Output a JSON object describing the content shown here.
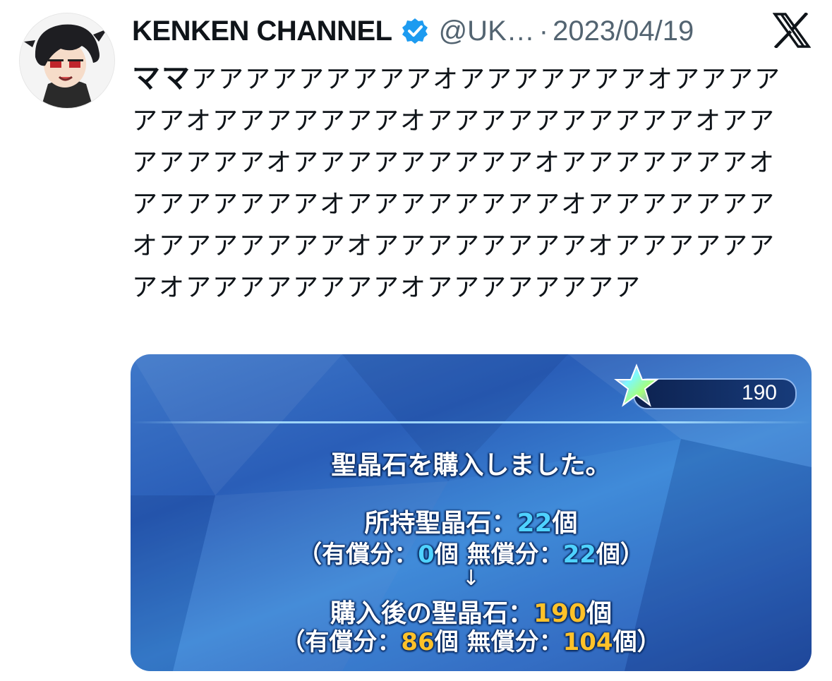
{
  "author": {
    "name": "KENKEN CHANNEL",
    "handle": "@UK…",
    "separator": "·",
    "date": "2023/04/19",
    "verified_icon": "verified-badge-icon"
  },
  "platform_icon": "x-logo-icon",
  "tweet": {
    "prefix": "ママ",
    "body": "アアアアアアアアアオアアアアアアアオアアアアアアオアアアアアアアオアアアアアアアアアアオアアアアアアアオアアアアアアアアアオアアアアアアアオアアアアアアアオアアアアアアアアオアアアアアアアオアアアアアアアオアアアアアアアアオアアアアアアアオアアアアアアアアオアアアアアアアア"
  },
  "media": {
    "counter_value": "190",
    "title": "聖晶石を購入しました。",
    "owned_label": "所持聖晶石：",
    "owned_value": "22",
    "unit": "個",
    "paid_label": "（有償分：",
    "paid_value_before": "0",
    "free_label": "無償分：",
    "free_value_before": "22",
    "close_paren": "）",
    "arrow": "↓",
    "after_label": "購入後の聖晶石：",
    "after_value": "190",
    "paid_value_after": "86",
    "free_value_after": "104"
  }
}
